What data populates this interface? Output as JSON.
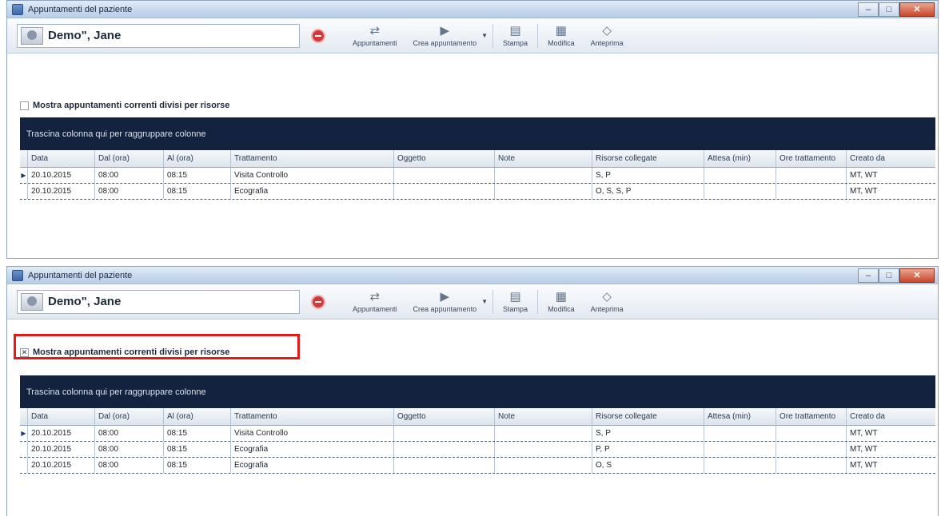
{
  "windows": [
    {
      "title": "Appuntamenti del paziente",
      "patient": "Demo\", Jane",
      "toolbar": {
        "btn1": "Appuntamenti",
        "btn2": "Crea appuntamento",
        "btn3": "Stampa",
        "btn4": "Modifica",
        "btn5": "Anteprima"
      },
      "checkbox": {
        "label": "Mostra appuntamenti correnti divisi per risorse",
        "checked": ""
      },
      "group_banner": "Trascina colonna qui per raggruppare colonne",
      "columns": [
        "Data",
        "Dal (ora)",
        "Al (ora)",
        "Trattamento",
        "Oggetto",
        "Note",
        "Risorse collegate",
        "Attesa (min)",
        "Ore trattamento",
        "Creato da"
      ],
      "rows": [
        [
          "20.10.2015",
          "08:00",
          "08:15",
          "Visita Controllo",
          "",
          "",
          "S, P",
          "",
          "",
          "MT, WT"
        ],
        [
          "20.10.2015",
          "08:00",
          "08:15",
          "Ecografia",
          "",
          "",
          "O, S, S, P",
          "",
          "",
          "MT, WT"
        ]
      ]
    },
    {
      "title": "Appuntamenti del paziente",
      "patient": "Demo\", Jane",
      "toolbar": {
        "btn1": "Appuntamenti",
        "btn2": "Crea appuntamento",
        "btn3": "Stampa",
        "btn4": "Modifica",
        "btn5": "Anteprima"
      },
      "checkbox": {
        "label": "Mostra appuntamenti correnti divisi per risorse",
        "checked": "✕"
      },
      "group_banner": "Trascina colonna qui per raggruppare colonne",
      "columns": [
        "Data",
        "Dal (ora)",
        "Al (ora)",
        "Trattamento",
        "Oggetto",
        "Note",
        "Risorse collegate",
        "Attesa (min)",
        "Ore trattamento",
        "Creato da"
      ],
      "rows": [
        [
          "20.10.2015",
          "08:00",
          "08:15",
          "Visita Controllo",
          "",
          "",
          "S, P",
          "",
          "",
          "MT, WT"
        ],
        [
          "20.10.2015",
          "08:00",
          "08:15",
          "Ecografia",
          "",
          "",
          "P, P",
          "",
          "",
          "MT, WT"
        ],
        [
          "20.10.2015",
          "08:00",
          "08:15",
          "Ecografia",
          "",
          "",
          "O, S",
          "",
          "",
          "MT, WT"
        ]
      ]
    }
  ]
}
